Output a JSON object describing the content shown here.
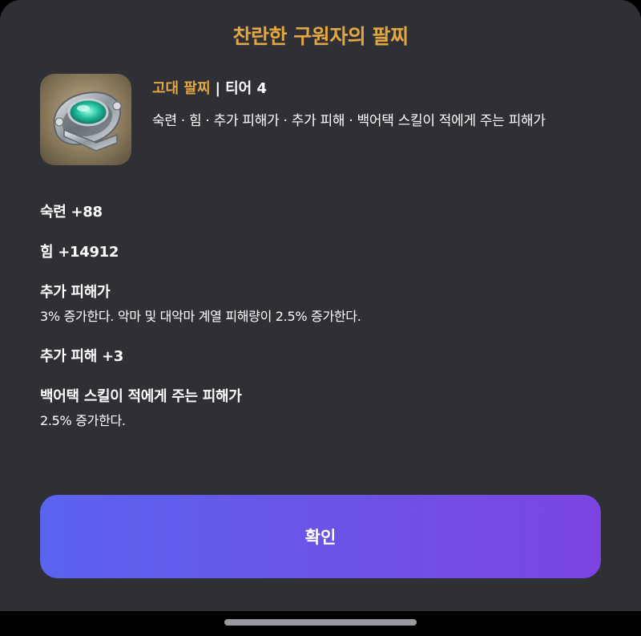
{
  "dialog": {
    "title": "찬란한 구원자의 팔찌"
  },
  "item": {
    "icon": "bracelet-icon",
    "grade": "고대 팔찌",
    "separator": "|",
    "tier": "티어 4",
    "tags": "숙련 · 힘 · 추가 피해가 · 추가 피해 · 백어택 스킬이 적에게 주는 피해가"
  },
  "stats": [
    {
      "title": "숙련 +88",
      "desc": ""
    },
    {
      "title": "힘 +14912",
      "desc": ""
    },
    {
      "title": "추가 피해가",
      "desc": "3% 증가한다. 악마 및 대악마 계열 피해량이 2.5% 증가한다."
    },
    {
      "title": "추가 피해 +3",
      "desc": ""
    },
    {
      "title": "백어택 스킬이 적에게 주는 피해가",
      "desc": "2.5% 증가한다."
    }
  ],
  "actions": {
    "confirm_label": "확인"
  },
  "colors": {
    "grade_accent": "#e2a642",
    "button_start": "#5a64ef",
    "button_end": "#7b44e0",
    "sheet_bg": "#2f3035"
  }
}
